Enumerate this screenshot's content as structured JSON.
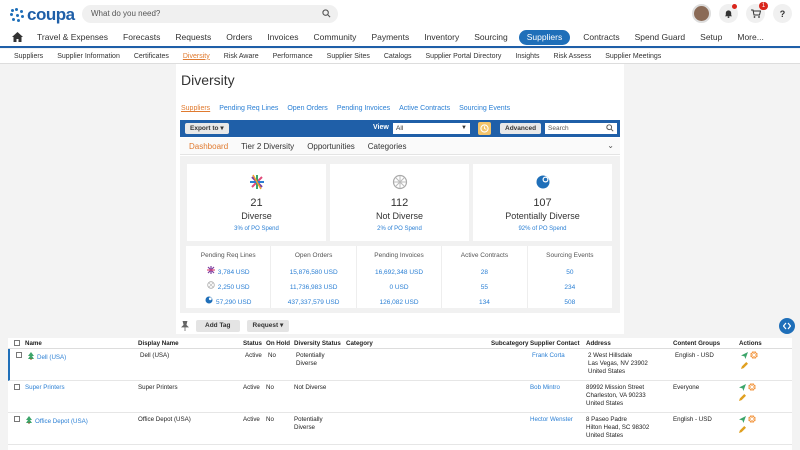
{
  "app": {
    "logo_text": "coupa",
    "search_placeholder": "What do you need?",
    "cart_count": "1",
    "help_label": "?"
  },
  "main_nav": [
    "Travel & Expenses",
    "Forecasts",
    "Requests",
    "Orders",
    "Invoices",
    "Community",
    "Payments",
    "Inventory",
    "Sourcing",
    "Suppliers",
    "Contracts",
    "Spend Guard",
    "Setup",
    "More..."
  ],
  "main_nav_active": "Suppliers",
  "sub_nav": [
    "Suppliers",
    "Supplier Information",
    "Certificates",
    "Diversity",
    "Risk Aware",
    "Performance",
    "Supplier Sites",
    "Catalogs",
    "Supplier Portal Directory",
    "Insights",
    "Risk Assess",
    "Supplier Meetings"
  ],
  "sub_nav_active": "Diversity",
  "page": {
    "title": "Diversity",
    "tabs": [
      "Suppliers",
      "Pending Req Lines",
      "Open Orders",
      "Pending Invoices",
      "Active Contracts",
      "Sourcing Events"
    ],
    "toolbar": {
      "export_label": "Export to",
      "view_label": "View",
      "view_value": "All",
      "advanced_label": "Advanced",
      "search_placeholder": "Search"
    },
    "dash_tabs": [
      "Dashboard",
      "Tier 2 Diversity",
      "Opportunities",
      "Categories"
    ],
    "cards": [
      {
        "count": "21",
        "label": "Diverse",
        "link": "3% of PO Spend",
        "icon": "diverse-icon"
      },
      {
        "count": "112",
        "label": "Not Diverse",
        "link": "2% of PO Spend",
        "icon": "not-diverse-icon"
      },
      {
        "count": "107",
        "label": "Potentially Diverse",
        "link": "92% of PO Spend",
        "icon": "potentially-diverse-icon"
      }
    ],
    "metrics": {
      "headers": [
        "Pending Req Lines",
        "Open Orders",
        "Pending Invoices",
        "Active Contracts",
        "Sourcing Events"
      ],
      "rows": [
        [
          "3,784 USD",
          "15,876,580 USD",
          "16,692,348 USD",
          "28",
          "50"
        ],
        [
          "2,250 USD",
          "11,736,983 USD",
          "0 USD",
          "55",
          "234"
        ],
        [
          "57,290 USD",
          "437,337,579 USD",
          "126,082 USD",
          "134",
          "508"
        ]
      ]
    },
    "add_tag_label": "Add Tag",
    "request_label": "Request"
  },
  "table": {
    "headers": {
      "name": "Name",
      "display_name": "Display Name",
      "status": "Status",
      "on_hold": "On Hold",
      "diversity_status": "Diversity Status",
      "category": "Category",
      "subcategory": "Subcategory",
      "supplier_contact": "Supplier Contact",
      "address": "Address",
      "content_groups": "Content Groups",
      "actions": "Actions"
    },
    "rows": [
      {
        "name": "Dell (USA)",
        "display_name": "Dell (USA)",
        "status": "Active",
        "on_hold": "No",
        "diversity_line1": "Potentially",
        "diversity_line2": "Diverse",
        "contact": "Frank Corta",
        "addr1": "2 West Hillsdale",
        "addr2": "Las Vegas, NV 23902",
        "addr3": "United States",
        "content_group": "English - USD"
      },
      {
        "name": "Super Printers",
        "display_name": "Super Printers",
        "status": "Active",
        "on_hold": "No",
        "diversity_line1": "Not Diverse",
        "diversity_line2": "",
        "contact": "Bob Mintro",
        "addr1": "89992 Mission Street",
        "addr2": "Charleston, VA 90233",
        "addr3": "United States",
        "content_group": "Everyone"
      },
      {
        "name": "Office Depot (USA)",
        "display_name": "Office Depot (USA)",
        "status": "Active",
        "on_hold": "No",
        "diversity_line1": "Potentially",
        "diversity_line2": "Diverse",
        "contact": "Hector Wenster",
        "addr1": "8 Paseo Padre",
        "addr2": "Hilton Head, SC 98302",
        "addr3": "United States",
        "content_group": "English - USD"
      }
    ]
  },
  "colors": {
    "brand": "#1f5fa8",
    "accent": "#e07a2f",
    "link": "#2a7fd4"
  }
}
